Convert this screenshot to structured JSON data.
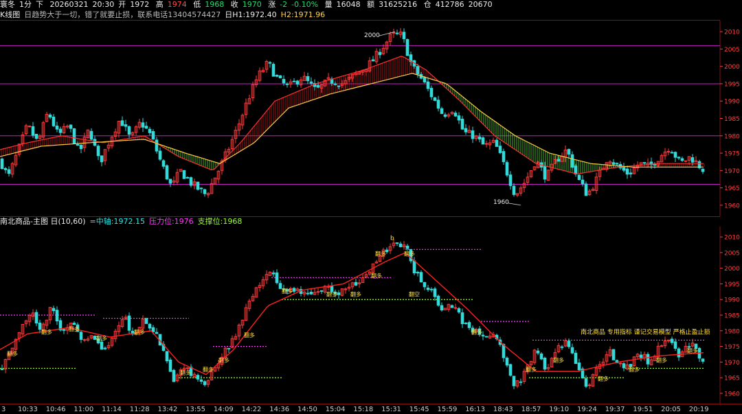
{
  "header": {
    "symbol": "寰冬",
    "period": "1分",
    "dir": "下",
    "date": "20260321",
    "time": "20:30",
    "open_label": "开",
    "open": "1972",
    "high_label": "高",
    "high": "1974",
    "low_label": "低",
    "low": "1968",
    "close_label": "收",
    "close": "1970",
    "change_label": "涨",
    "change": "-2",
    "change_pct": "-0.10%",
    "volume_label": "量",
    "volume": "16048",
    "amount_label": "额",
    "amount": "31625216",
    "oi_label": "仓",
    "oi": "412786",
    "oi2": "20670"
  },
  "kline_info": {
    "name": "K线图",
    "note": "日趋势大于一切，错了就要止损，联系电话13404574427",
    "h1": "日H1:1972.40",
    "h2": "H2:1971.96"
  },
  "sub_info": {
    "name": "南北商品-主图 日(10,60)",
    "mid": "=中轴:1972.15",
    "pressure": "压力位:1976",
    "support": "支撑位:1968"
  },
  "chart_data": [
    {
      "type": "candlestick",
      "pane": "main",
      "y_ticks": [
        1960,
        1965,
        1970,
        1975,
        1980,
        1985,
        1990,
        1995,
        2000,
        2005,
        2010
      ],
      "ylim": [
        1958,
        2012
      ],
      "hlines": [
        2006,
        1995,
        1980,
        1966
      ],
      "annotations": [
        {
          "text": "2000",
          "value": 2009
        },
        {
          "text": "1960",
          "value": 1961
        }
      ],
      "path": [
        [
          0,
          1973
        ],
        [
          12,
          1968
        ],
        [
          25,
          1975
        ],
        [
          40,
          1983
        ],
        [
          55,
          1978
        ],
        [
          70,
          1987
        ],
        [
          85,
          1980
        ],
        [
          100,
          1983
        ],
        [
          115,
          1975
        ],
        [
          130,
          1982
        ],
        [
          145,
          1972
        ],
        [
          160,
          1979
        ],
        [
          175,
          1985
        ],
        [
          190,
          1979
        ],
        [
          205,
          1984
        ],
        [
          220,
          1980
        ],
        [
          235,
          1972
        ],
        [
          250,
          1965
        ],
        [
          262,
          1970
        ],
        [
          280,
          1966
        ],
        [
          300,
          1963
        ],
        [
          318,
          1970
        ],
        [
          332,
          1976
        ],
        [
          345,
          1982
        ],
        [
          360,
          1990
        ],
        [
          375,
          1997
        ],
        [
          390,
          2001
        ],
        [
          405,
          1996
        ],
        [
          420,
          1994
        ],
        [
          440,
          1997
        ],
        [
          460,
          1993
        ],
        [
          480,
          1996
        ],
        [
          500,
          1995
        ],
        [
          520,
          1998
        ],
        [
          540,
          2001
        ],
        [
          555,
          2005
        ],
        [
          570,
          2009
        ],
        [
          585,
          2009
        ],
        [
          600,
          2000
        ],
        [
          615,
          1996
        ],
        [
          630,
          1991
        ],
        [
          645,
          1986
        ],
        [
          660,
          1988
        ],
        [
          675,
          1981
        ],
        [
          690,
          1980
        ],
        [
          705,
          1977
        ],
        [
          720,
          1978
        ],
        [
          735,
          1971
        ],
        [
          750,
          1963
        ],
        [
          765,
          1967
        ],
        [
          780,
          1973
        ],
        [
          795,
          1968
        ],
        [
          810,
          1973
        ],
        [
          825,
          1976
        ],
        [
          840,
          1968
        ],
        [
          855,
          1963
        ],
        [
          870,
          1968
        ],
        [
          885,
          1974
        ],
        [
          900,
          1971
        ],
        [
          915,
          1969
        ],
        [
          930,
          1972
        ],
        [
          945,
          1971
        ],
        [
          960,
          1974
        ],
        [
          975,
          1977
        ],
        [
          990,
          1972
        ],
        [
          1005,
          1974
        ],
        [
          1025,
          1970
        ]
      ],
      "ma_fast": [
        [
          0,
          1976
        ],
        [
          40,
          1978
        ],
        [
          90,
          1980
        ],
        [
          150,
          1978
        ],
        [
          210,
          1980
        ],
        [
          260,
          1974
        ],
        [
          310,
          1970
        ],
        [
          350,
          1978
        ],
        [
          400,
          1990
        ],
        [
          460,
          1995
        ],
        [
          530,
          1999
        ],
        [
          585,
          2003
        ],
        [
          620,
          1999
        ],
        [
          670,
          1990
        ],
        [
          720,
          1980
        ],
        [
          780,
          1972
        ],
        [
          840,
          1969
        ],
        [
          900,
          1971
        ],
        [
          960,
          1972
        ],
        [
          1025,
          1972
        ]
      ],
      "ma_slow": [
        [
          0,
          1974
        ],
        [
          60,
          1977
        ],
        [
          130,
          1978
        ],
        [
          210,
          1979
        ],
        [
          270,
          1975
        ],
        [
          320,
          1972
        ],
        [
          370,
          1978
        ],
        [
          420,
          1988
        ],
        [
          480,
          1992
        ],
        [
          540,
          1995
        ],
        [
          600,
          1998
        ],
        [
          650,
          1995
        ],
        [
          700,
          1987
        ],
        [
          750,
          1980
        ],
        [
          800,
          1975
        ],
        [
          860,
          1972
        ],
        [
          920,
          1971
        ],
        [
          1025,
          1971
        ]
      ]
    },
    {
      "type": "candlestick",
      "pane": "sub",
      "y_ticks": [
        1960,
        1965,
        1970,
        1975,
        1980,
        1985,
        1990,
        1995,
        2000,
        2005,
        2010
      ],
      "ylim": [
        1958,
        2012
      ],
      "hlines": [
        {
          "x1": 0,
          "x2": 140,
          "value": 1985,
          "color": "#ff3cff"
        },
        {
          "x1": 150,
          "x2": 275,
          "value": 1984,
          "color": "#ff3cff"
        },
        {
          "x1": 310,
          "x2": 390,
          "value": 1975,
          "color": "#ff3cff"
        },
        {
          "x1": 395,
          "x2": 570,
          "value": 1997,
          "color": "#ff3cff"
        },
        {
          "x1": 590,
          "x2": 700,
          "value": 2006,
          "color": "#ff3cff"
        },
        {
          "x1": 700,
          "x2": 770,
          "value": 1983,
          "color": "#ff3cff"
        },
        {
          "x1": 775,
          "x2": 1025,
          "value": 1977,
          "color": "#ff3cff"
        },
        {
          "x1": 0,
          "x2": 110,
          "value": 1968,
          "color": "#9cff3c"
        },
        {
          "x1": 260,
          "x2": 410,
          "value": 1965,
          "color": "#9cff3c"
        },
        {
          "x1": 410,
          "x2": 690,
          "value": 1990,
          "color": "#9cff3c"
        },
        {
          "x1": 770,
          "x2": 910,
          "value": 1965,
          "color": "#9cff3c"
        },
        {
          "x1": 910,
          "x2": 1025,
          "value": 1968,
          "color": "#9cff3c"
        }
      ],
      "signals": [
        {
          "text": "翻多",
          "x": 10,
          "value": 1972
        },
        {
          "text": "翻多",
          "x": 60,
          "value": 1979
        },
        {
          "text": "翻多",
          "x": 100,
          "value": 1980
        },
        {
          "text": "翻多",
          "x": 140,
          "value": 1977
        },
        {
          "text": "翻多",
          "x": 195,
          "value": 1979
        },
        {
          "text": "翻多",
          "x": 262,
          "value": 1966
        },
        {
          "text": "翻多",
          "x": 295,
          "value": 1967
        },
        {
          "text": "翻多",
          "x": 318,
          "value": 1970
        },
        {
          "text": "翻多",
          "x": 355,
          "value": 1978
        },
        {
          "text": "翻多",
          "x": 410,
          "value": 1992
        },
        {
          "text": "翻多",
          "x": 475,
          "value": 1991
        },
        {
          "text": "翻多",
          "x": 510,
          "value": 1991
        },
        {
          "text": "翻多",
          "x": 540,
          "value": 1997
        },
        {
          "text": "翻多",
          "x": 546,
          "value": 2004
        },
        {
          "text": "翻多",
          "x": 588,
          "value": 2004
        },
        {
          "text": "翻空",
          "x": 595,
          "value": 1991
        },
        {
          "text": "翻多",
          "x": 686,
          "value": 1979
        },
        {
          "text": "翻多",
          "x": 765,
          "value": 1967
        },
        {
          "text": "翻多",
          "x": 805,
          "value": 1970
        },
        {
          "text": "翻多",
          "x": 870,
          "value": 1964
        },
        {
          "text": "翻多",
          "x": 915,
          "value": 1967
        },
        {
          "text": "翻多",
          "x": 955,
          "value": 1970
        },
        {
          "text": "翻多",
          "x": 1000,
          "value": 1973
        }
      ],
      "banner": "南北商品  专用指标  谨记交易模型  严格止盈止损",
      "marker": "b",
      "path": [
        [
          0,
          1968
        ],
        [
          15,
          1972
        ],
        [
          30,
          1980
        ],
        [
          45,
          1986
        ],
        [
          60,
          1980
        ],
        [
          75,
          1988
        ],
        [
          90,
          1980
        ],
        [
          105,
          1983
        ],
        [
          120,
          1975
        ],
        [
          135,
          1980
        ],
        [
          150,
          1972
        ],
        [
          165,
          1978
        ],
        [
          180,
          1985
        ],
        [
          195,
          1978
        ],
        [
          210,
          1984
        ],
        [
          225,
          1980
        ],
        [
          240,
          1972
        ],
        [
          252,
          1964
        ],
        [
          265,
          1968
        ],
        [
          285,
          1966
        ],
        [
          300,
          1963
        ],
        [
          318,
          1970
        ],
        [
          335,
          1976
        ],
        [
          350,
          1982
        ],
        [
          365,
          1990
        ],
        [
          380,
          1996
        ],
        [
          395,
          1999
        ],
        [
          410,
          1992
        ],
        [
          430,
          1994
        ],
        [
          450,
          1991
        ],
        [
          470,
          1994
        ],
        [
          490,
          1992
        ],
        [
          510,
          1994
        ],
        [
          530,
          1997
        ],
        [
          545,
          2002
        ],
        [
          560,
          2006
        ],
        [
          575,
          2008
        ],
        [
          590,
          2008
        ],
        [
          600,
          2000
        ],
        [
          615,
          1996
        ],
        [
          630,
          1992
        ],
        [
          645,
          1986
        ],
        [
          660,
          1989
        ],
        [
          675,
          1982
        ],
        [
          690,
          1980
        ],
        [
          705,
          1977
        ],
        [
          720,
          1979
        ],
        [
          735,
          1971
        ],
        [
          750,
          1962
        ],
        [
          765,
          1967
        ],
        [
          780,
          1974
        ],
        [
          795,
          1967
        ],
        [
          810,
          1974
        ],
        [
          825,
          1976
        ],
        [
          840,
          1968
        ],
        [
          855,
          1962
        ],
        [
          870,
          1968
        ],
        [
          885,
          1974
        ],
        [
          900,
          1970
        ],
        [
          915,
          1968
        ],
        [
          930,
          1973
        ],
        [
          945,
          1970
        ],
        [
          960,
          1975
        ],
        [
          975,
          1978
        ],
        [
          990,
          1972
        ],
        [
          1005,
          1976
        ],
        [
          1025,
          1970
        ]
      ],
      "ma": [
        [
          0,
          1974
        ],
        [
          40,
          1979
        ],
        [
          100,
          1981
        ],
        [
          160,
          1978
        ],
        [
          220,
          1980
        ],
        [
          260,
          1970
        ],
        [
          300,
          1966
        ],
        [
          340,
          1974
        ],
        [
          390,
          1988
        ],
        [
          440,
          1993
        ],
        [
          500,
          1995
        ],
        [
          560,
          2002
        ],
        [
          590,
          2005
        ],
        [
          630,
          1997
        ],
        [
          680,
          1987
        ],
        [
          730,
          1976
        ],
        [
          780,
          1967
        ],
        [
          840,
          1967
        ],
        [
          900,
          1970
        ],
        [
          960,
          1972
        ],
        [
          1025,
          1973
        ]
      ]
    }
  ],
  "time_axis": [
    "3",
    "10:33",
    "10:46",
    "11:00",
    "11:14",
    "11:28",
    "13:42",
    "13:55",
    "14:09",
    "14:22",
    "14:36",
    "14:50",
    "15:04",
    "15:18",
    "15:31",
    "15:45",
    "15:59",
    "16:13",
    "18:43",
    "18:57",
    "19:10",
    "19:24",
    "19:37",
    "19:51",
    "20:05",
    "20:19"
  ],
  "colors": {
    "up": "#ff3a3a",
    "down": "#33dada",
    "ma_fast": "#ff3030",
    "ma_slow": "#ffcc44",
    "axis": "#ff4040",
    "border": "#8a1010"
  }
}
